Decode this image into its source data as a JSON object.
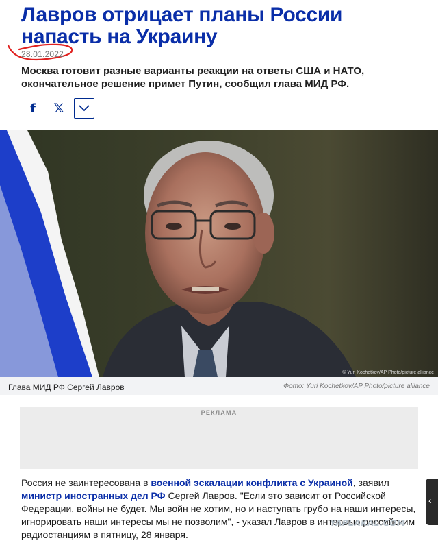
{
  "article": {
    "headline": "Лавров отрицает планы России напасть на Украину",
    "date": "28.01.2022",
    "teaser": "Москва готовит разные варианты реакции на ответы США и НАТО, окончательное решение примет Путин, сообщил глава МИД РФ."
  },
  "share": {
    "facebook_glyph": "f",
    "x_glyph": "𝕏"
  },
  "photo": {
    "overlay_credit": "© Yuri Kochetkov/AP Photo/picture alliance",
    "caption": "Глава МИД РФ Сергей Лавров",
    "credit": "Фото: Yuri Kochetkov/AP Photo/picture alliance"
  },
  "ad": {
    "label": "РЕКЛАМА"
  },
  "body": {
    "p1_a": "Россия не заинтересована в ",
    "link1": "военной эскалации конфликта с Украиной",
    "p1_b": ", заявил ",
    "link2": "министр иностранных дел РФ",
    "p1_c": " Сергей Лавров. \"Если это зависит от Российской Федерации, войны не будет. Мы войн не хотим, но и наступать грубо на наши интересы, игнорировать наши интересы мы не позволим\", - указал Лавров в интервью российским радиостанциям в пятницу, 28 января."
  },
  "watermark": {
    "text": "YAPLAKAL.COM"
  },
  "side_tab": {
    "glyph": "‹"
  },
  "colors": {
    "headline": "#0a2ea8",
    "link": "#0a2ea8",
    "annotation": "#e0201e"
  }
}
